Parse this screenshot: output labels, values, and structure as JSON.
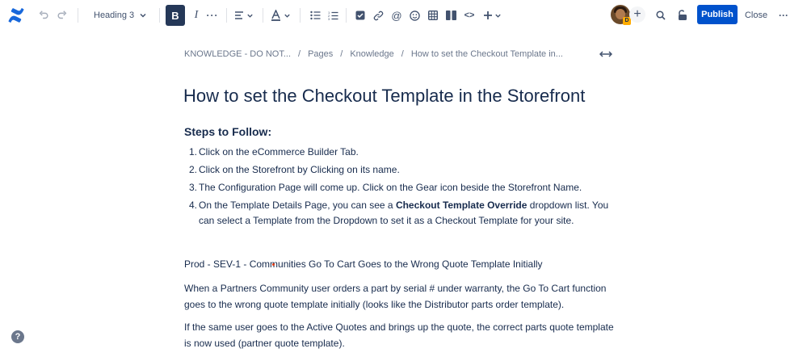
{
  "toolbar": {
    "text_style": "Heading 3",
    "bold_label": "B",
    "italic_label": "I",
    "more_label": "···",
    "mention_label": "@",
    "code_label": "<>",
    "add_label": "+",
    "avatar_badge": "D",
    "publish_label": "Publish",
    "close_label": "Close",
    "overflow_label": "···"
  },
  "icons": {
    "logo": "confluence-logo-icon",
    "undo": "undo-icon",
    "redo": "redo-icon",
    "chevron": "chevron-down-icon",
    "align": "align-left-icon",
    "text_color": "text-color-icon",
    "bullet_list": "bullet-list-icon",
    "numbered_list": "numbered-list-icon",
    "task": "task-checkbox-icon",
    "link": "link-icon",
    "emoji": "emoji-icon",
    "table": "table-icon",
    "layout": "layout-columns-icon",
    "insert": "insert-plus-icon",
    "search": "search-icon",
    "restrictions": "unlock-icon",
    "expand": "expand-width-icon",
    "help": "help-icon"
  },
  "colors": {
    "brand": "#0052cc",
    "text": "#172b4d",
    "subtle": "#6b778c",
    "active_button": "#253858"
  },
  "breadcrumb": {
    "items": [
      "KNOWLEDGE - DO NOT...",
      "Pages",
      "Knowledge",
      "How to set the Checkout Template in..."
    ],
    "separator": "/"
  },
  "page": {
    "title": "How to set the Checkout Template in the Storefront",
    "steps_heading": "Steps to Follow:",
    "steps": [
      {
        "num": "1.",
        "text": "Click on the eCommerce Builder Tab."
      },
      {
        "num": "2.",
        "text": "Click on the Storefront by Clicking on its name."
      },
      {
        "num": "3.",
        "text": "The Configuration Page will come up. Click on the Gear icon beside the Storefront Name."
      },
      {
        "num": "4.",
        "before": "On the Template Details Page, you can see a ",
        "bold": "Checkout Template Override",
        "after": " dropdown list. You can select a Template from the Dropdown to set it as a Checkout Template for your site."
      }
    ],
    "incident_title": "Prod - SEV-1 - Communities Go To Cart Goes to the Wrong Quote Template Initially",
    "paragraph1": "When a Partners Community user orders a part by serial # under warranty, the Go To Cart function goes to the wrong quote template initially (looks like the Distributor parts order template).",
    "paragraph2": "If the same user goes to the Active Quotes and brings up the quote, the correct parts quote template is now used (partner quote template)."
  },
  "help": {
    "label": "?"
  }
}
